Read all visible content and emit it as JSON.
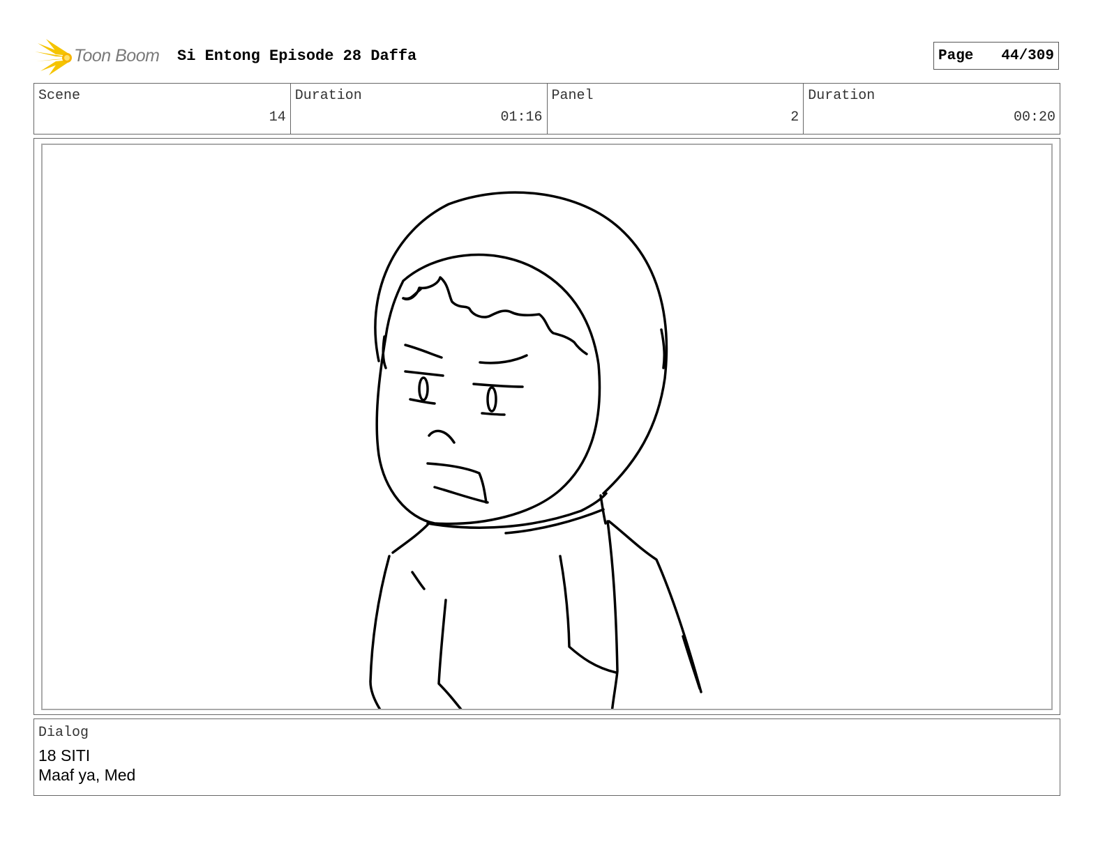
{
  "header": {
    "logo_text": "Toon Boom",
    "project_title": "Si Entong Episode 28 Daffa",
    "page_label": "Page",
    "page_value": "44/309"
  },
  "info": {
    "scene_label": "Scene",
    "scene_value": "14",
    "scene_duration_label": "Duration",
    "scene_duration_value": "01:16",
    "panel_label": "Panel",
    "panel_value": "2",
    "panel_duration_label": "Duration",
    "panel_duration_value": "00:20"
  },
  "dialog": {
    "label": "Dialog",
    "line1": "18 SITI",
    "line2": "Maaf ya, Med"
  },
  "colors": {
    "logo_sun": "#f5c400",
    "logo_text": "#7a7a7a",
    "border": "#666666"
  }
}
